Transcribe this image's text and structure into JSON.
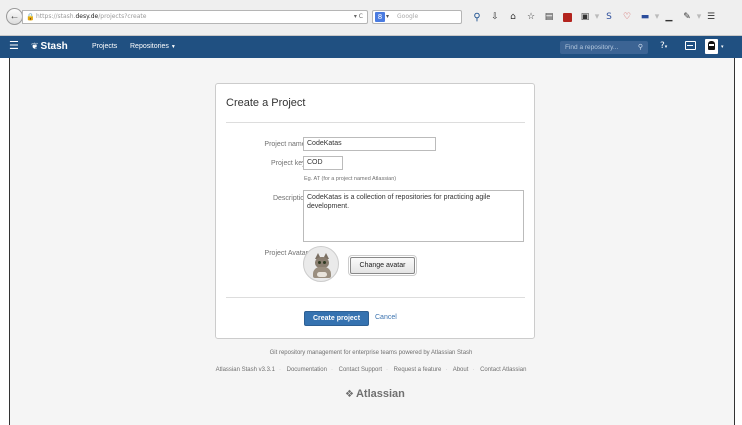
{
  "browser": {
    "url_prefix": "https://stash.",
    "url_host": "desy.de",
    "url_path": "/projects?create",
    "url_controls": "▾ C",
    "search_placeholder": "Google",
    "search_engine_glyph": "8",
    "icons": [
      "magnifier-icon",
      "download-icon",
      "home-icon",
      "star-icon",
      "clipboard-icon",
      "red-addon-icon",
      "picture-icon",
      "s-addon-icon",
      "heart-addon-icon",
      "monitor-addon-icon",
      "bar-chart-icon",
      "edit-icon",
      "menu-icon"
    ]
  },
  "header": {
    "logo_text": "Stash",
    "nav": {
      "projects": "Projects",
      "repositories": "Repositories"
    },
    "repo_search_placeholder": "Find a repository...",
    "help_caret": "▾",
    "avatar_caret": "▾"
  },
  "form": {
    "title": "Create a Project",
    "project_name_label": "Project name",
    "project_name_value": "CodeKatas",
    "project_key_label": "Project key",
    "project_key_value": "COD",
    "project_key_hint": "Eg. AT (for a project named Atlassian)",
    "required_mark": "*",
    "description_label": "Description",
    "description_value": "CodeKatas is a collection of repositories for practicing agile development.",
    "avatar_label": "Project Avatar",
    "change_avatar_label": "Change avatar",
    "create_label": "Create project",
    "cancel_label": "Cancel"
  },
  "footer": {
    "tagline": "Git repository management for enterprise teams powered by Atlassian Stash",
    "links": [
      "Atlassian Stash v3.3.1",
      "Documentation",
      "Contact Support",
      "Request a feature",
      "About",
      "Contact Atlassian"
    ],
    "logo_text": "Atlassian"
  },
  "colors": {
    "header_bg": "#205081",
    "primary_button": "#3572b0",
    "link": "#3b73af",
    "required": "#d04437"
  }
}
